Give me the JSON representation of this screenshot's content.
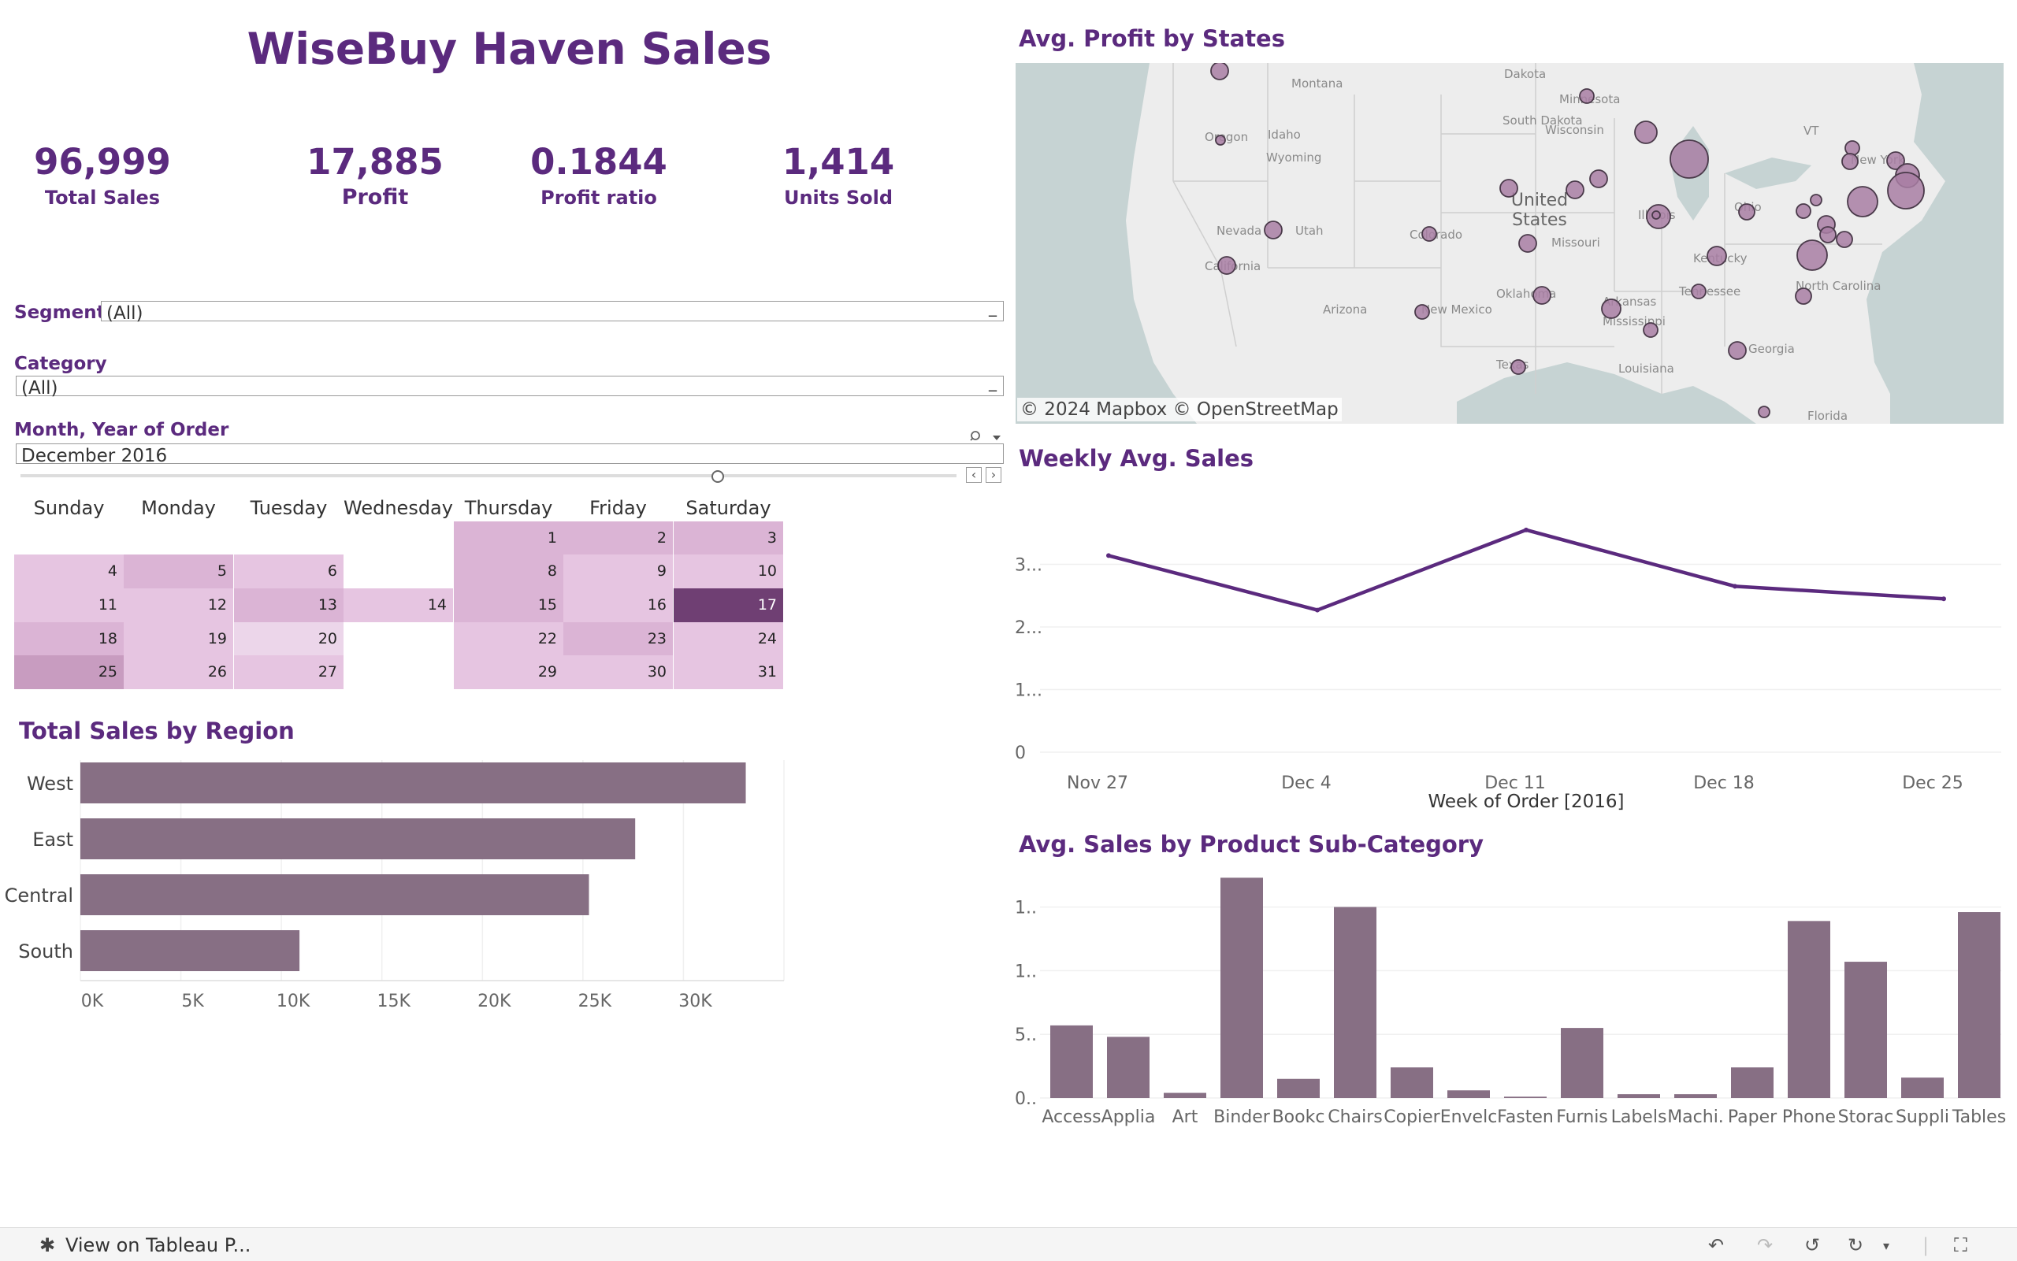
{
  "dashboard": {
    "title": "WiseBuy Haven Sales"
  },
  "kpis": [
    {
      "value": "96,999",
      "label": "Total Sales"
    },
    {
      "value": "17,885",
      "label": "Profit"
    },
    {
      "value": "0.1844",
      "label": "Profit ratio"
    },
    {
      "value": "1,414",
      "label": "Units Sold"
    }
  ],
  "filters": {
    "segment": {
      "label": "Segment",
      "value": "(All)"
    },
    "category": {
      "label": "Category",
      "value": "(All)"
    },
    "month": {
      "label": "Month, Year of Order",
      "value": "December 2016"
    }
  },
  "calendar": {
    "days": [
      "Sunday",
      "Monday",
      "Tuesday",
      "Wednesday",
      "Thursday",
      "Friday",
      "Saturday"
    ],
    "weeks": [
      [
        null,
        null,
        null,
        null,
        "1",
        "2",
        "3"
      ],
      [
        "4",
        "5",
        "6",
        null,
        "8",
        "9",
        "10"
      ],
      [
        "11",
        "12",
        "13",
        "14",
        "15",
        "16",
        "17"
      ],
      [
        "18",
        "19",
        "20",
        null,
        "22",
        "23",
        "24"
      ],
      [
        "25",
        "26",
        "27",
        null,
        "29",
        "30",
        "31"
      ]
    ],
    "intensity": [
      [
        null,
        null,
        null,
        null,
        2,
        2,
        2
      ],
      [
        1,
        2,
        1,
        null,
        2,
        1,
        1
      ],
      [
        1,
        1,
        2,
        1,
        2,
        1,
        5
      ],
      [
        2,
        1,
        0,
        null,
        1,
        2,
        1
      ],
      [
        3,
        1,
        1,
        null,
        1,
        1,
        1
      ]
    ]
  },
  "region_chart": {
    "title": "Total Sales by Region",
    "chart_data": {
      "type": "bar",
      "categories": [
        "West",
        "East",
        "Central",
        "South"
      ],
      "values": [
        33100,
        27600,
        25300,
        10900
      ],
      "xlim": [
        0,
        35000
      ],
      "xticks": [
        "0K",
        "5K",
        "10K",
        "15K",
        "20K",
        "25K",
        "30K"
      ]
    }
  },
  "map": {
    "title": "Avg. Profit by States",
    "attribution": "© 2024 Mapbox © OpenStreetMap",
    "labels": [
      "Montana",
      "Dakota",
      "Minnesota",
      "South Dakota",
      "Wisconsin",
      "Idaho",
      "Oregon",
      "Wyoming",
      "United States",
      "Nevada",
      "Utah",
      "Colorado",
      "Missouri",
      "Illinois",
      "Kentucky",
      "California",
      "Arizona",
      "New Mexico",
      "Oklahoma",
      "Arkansas",
      "Tennessee",
      "North Carolina",
      "Mississippi",
      "Georgia",
      "Texas",
      "Louisiana",
      "Florida",
      "New York",
      "Ohio",
      "VT"
    ]
  },
  "weekly_chart": {
    "title": "Weekly Avg. Sales",
    "chart_data": {
      "type": "line",
      "x": [
        "Nov 27",
        "Dec 4",
        "Dec 11",
        "Dec 18",
        "Dec 25"
      ],
      "values": [
        3.14,
        2.27,
        3.55,
        2.65,
        2.45
      ],
      "ylim": [
        0,
        3.9
      ],
      "yticks": [
        "0",
        "1...",
        "2...",
        "3..."
      ],
      "xlabel": "Week of Order [2016]"
    }
  },
  "subcat_chart": {
    "title": "Avg. Sales by Product Sub-Category",
    "chart_data": {
      "type": "bar",
      "categories": [
        "Access",
        "Applia",
        "Art",
        "Binder",
        "Bookc",
        "Chairs",
        "Copier",
        "Envelc",
        "Fasten",
        "Furnis",
        "Labels",
        "Machi.",
        "Paper",
        "Phone",
        "Storac",
        "Suppli",
        "Tables"
      ],
      "values": [
        0.57,
        0.48,
        0.04,
        1.73,
        0.15,
        1.5,
        0.24,
        0.06,
        0.01,
        0.55,
        0.03,
        0.03,
        0.24,
        1.39,
        1.07,
        0.16,
        1.46
      ],
      "ylim": [
        0,
        1.85
      ],
      "yticks": [
        "0..",
        "5..",
        "1..",
        "1.."
      ]
    }
  },
  "footer": {
    "view_label": "View on Tableau P..."
  }
}
